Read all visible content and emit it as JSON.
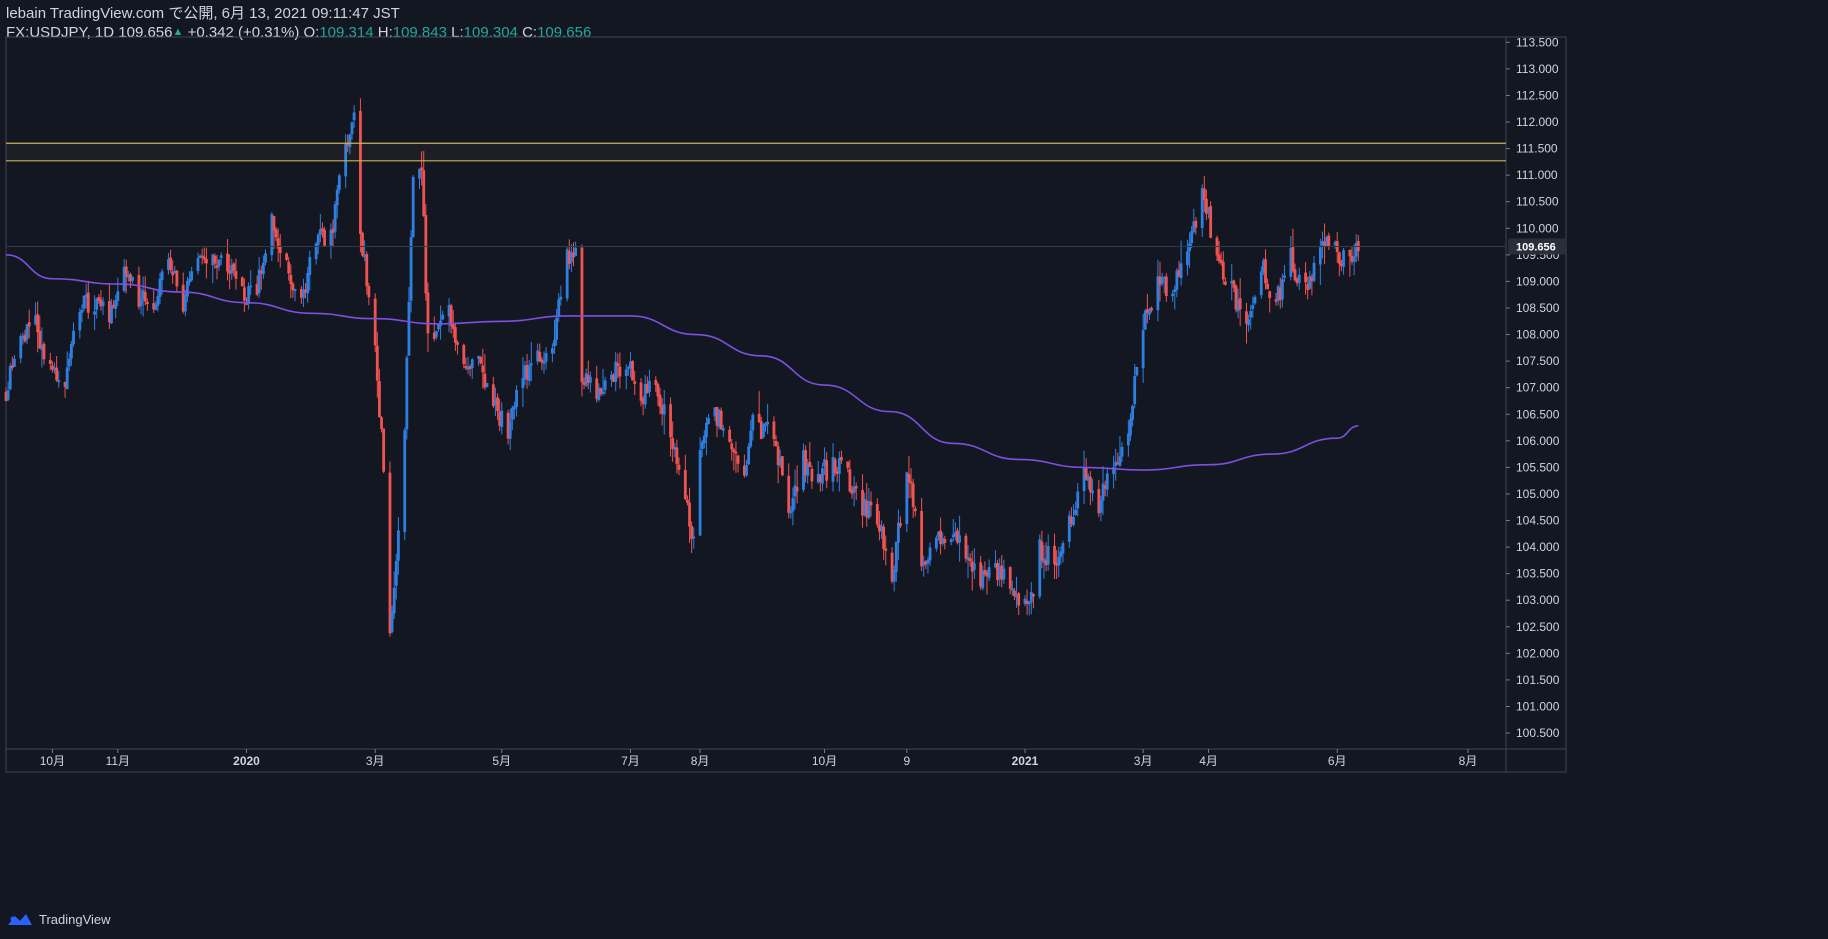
{
  "header": {
    "publisher": "lebain TradingView.com で公開, 6月 13, 2021 09:11:47 JST",
    "symbol": "FX:USDJPY, 1D",
    "last": "109.656",
    "change_icon": "up-triangle-icon",
    "change": "+0.342 (+0.31%)",
    "o_label": "O:",
    "o_value": "109.314",
    "h_label": "H:",
    "h_value": "109.843",
    "l_label": "L:",
    "l_value": "109.304",
    "c_label": "C:",
    "c_value": "109.656"
  },
  "footer": {
    "brand": "TradingView",
    "logo_icon": "tradingview-logo-icon"
  },
  "colors": {
    "background": "#131722",
    "up": "#2f7fe0",
    "down": "#f05350",
    "ma": "#7e4fe0",
    "resistance": "#c9b458",
    "text": "#d1d4dc",
    "green": "#26a69a"
  },
  "chart_data": {
    "type": "candlestick",
    "symbol": "FX:USDJPY",
    "timeframe": "1D",
    "y_axis": {
      "min": 100.2,
      "max": 113.6,
      "ticks": [
        "113.500",
        "113.000",
        "112.500",
        "112.000",
        "111.500",
        "111.000",
        "110.500",
        "110.000",
        "109.500",
        "109.000",
        "108.500",
        "108.000",
        "107.500",
        "107.000",
        "106.500",
        "106.000",
        "105.500",
        "105.000",
        "104.500",
        "104.000",
        "103.500",
        "103.000",
        "102.500",
        "102.000",
        "101.500",
        "101.000",
        "100.500"
      ]
    },
    "x_axis": {
      "start": "2019-09-09",
      "end": "2021-08-20",
      "ticks": [
        {
          "label": "10月",
          "date": "2019-10-01"
        },
        {
          "label": "11月",
          "date": "2019-11-01"
        },
        {
          "label": "2020",
          "date": "2020-01-01",
          "bold": true
        },
        {
          "label": "3月",
          "date": "2020-03-02"
        },
        {
          "label": "5月",
          "date": "2020-05-01"
        },
        {
          "label": "7月",
          "date": "2020-07-01"
        },
        {
          "label": "8月",
          "date": "2020-08-03"
        },
        {
          "label": "10月",
          "date": "2020-10-01"
        },
        {
          "label": "9",
          "date": "2020-11-09"
        },
        {
          "label": "2021",
          "date": "2021-01-04",
          "bold": true
        },
        {
          "label": "3月",
          "date": "2021-03-01"
        },
        {
          "label": "4月",
          "date": "2021-04-01"
        },
        {
          "label": "6月",
          "date": "2021-06-01"
        },
        {
          "label": "8月",
          "date": "2021-08-02"
        }
      ]
    },
    "last_price": "109.656",
    "resistance_zone": [
      111.27,
      111.6
    ],
    "close_path": [
      [
        "2019-09-09",
        106.9
      ],
      [
        "2019-09-16",
        107.9
      ],
      [
        "2019-09-23",
        108.2
      ],
      [
        "2019-09-30",
        107.3
      ],
      [
        "2019-10-07",
        107.0
      ],
      [
        "2019-10-14",
        108.6
      ],
      [
        "2019-10-21",
        108.6
      ],
      [
        "2019-10-28",
        108.4
      ],
      [
        "2019-11-04",
        109.2
      ],
      [
        "2019-11-11",
        108.7
      ],
      [
        "2019-11-18",
        108.6
      ],
      [
        "2019-11-25",
        109.4
      ],
      [
        "2019-12-02",
        108.6
      ],
      [
        "2019-12-09",
        109.5
      ],
      [
        "2019-12-16",
        109.4
      ],
      [
        "2019-12-23",
        109.4
      ],
      [
        "2019-12-30",
        108.7
      ],
      [
        "2020-01-06",
        108.9
      ],
      [
        "2020-01-13",
        110.1
      ],
      [
        "2020-01-20",
        109.3
      ],
      [
        "2020-01-27",
        108.6
      ],
      [
        "2020-02-03",
        109.8
      ],
      [
        "2020-02-10",
        109.8
      ],
      [
        "2020-02-17",
        111.6
      ],
      [
        "2020-02-21",
        112.1
      ],
      [
        "2020-02-24",
        110.0
      ],
      [
        "2020-03-02",
        107.8
      ],
      [
        "2020-03-06",
        105.5
      ],
      [
        "2020-03-09",
        102.3
      ],
      [
        "2020-03-13",
        104.5
      ],
      [
        "2020-03-16",
        106.3
      ],
      [
        "2020-03-20",
        110.8
      ],
      [
        "2020-03-24",
        111.2
      ],
      [
        "2020-03-27",
        107.8
      ],
      [
        "2020-03-30",
        108.0
      ],
      [
        "2020-04-06",
        108.5
      ],
      [
        "2020-04-13",
        107.3
      ],
      [
        "2020-04-20",
        107.6
      ],
      [
        "2020-04-27",
        106.7
      ],
      [
        "2020-05-04",
        106.2
      ],
      [
        "2020-05-11",
        107.2
      ],
      [
        "2020-05-18",
        107.6
      ],
      [
        "2020-05-25",
        107.7
      ],
      [
        "2020-06-01",
        109.5
      ],
      [
        "2020-06-05",
        109.6
      ],
      [
        "2020-06-08",
        107.3
      ],
      [
        "2020-06-15",
        106.9
      ],
      [
        "2020-06-22",
        107.2
      ],
      [
        "2020-06-29",
        107.5
      ],
      [
        "2020-07-06",
        106.9
      ],
      [
        "2020-07-13",
        107.0
      ],
      [
        "2020-07-20",
        106.1
      ],
      [
        "2020-07-31",
        104.2
      ],
      [
        "2020-08-03",
        105.8
      ],
      [
        "2020-08-10",
        106.6
      ],
      [
        "2020-08-17",
        105.8
      ],
      [
        "2020-08-24",
        105.4
      ],
      [
        "2020-08-28",
        106.3
      ],
      [
        "2020-09-07",
        106.1
      ],
      [
        "2020-09-14",
        104.6
      ],
      [
        "2020-09-21",
        105.6
      ],
      [
        "2020-09-28",
        105.3
      ],
      [
        "2020-10-05",
        105.6
      ],
      [
        "2020-10-12",
        105.3
      ],
      [
        "2020-10-19",
        104.7
      ],
      [
        "2020-10-26",
        104.6
      ],
      [
        "2020-11-02",
        103.4
      ],
      [
        "2020-11-09",
        105.5
      ],
      [
        "2020-11-16",
        103.8
      ],
      [
        "2020-11-23",
        104.1
      ],
      [
        "2020-11-30",
        104.2
      ],
      [
        "2020-12-07",
        104.0
      ],
      [
        "2020-12-14",
        103.3
      ],
      [
        "2020-12-21",
        103.6
      ],
      [
        "2020-12-28",
        103.2
      ],
      [
        "2021-01-06",
        102.8
      ],
      [
        "2021-01-11",
        104.0
      ],
      [
        "2021-01-18",
        103.7
      ],
      [
        "2021-01-25",
        104.4
      ],
      [
        "2021-02-01",
        105.3
      ],
      [
        "2021-02-08",
        104.8
      ],
      [
        "2021-02-15",
        105.5
      ],
      [
        "2021-02-22",
        106.1
      ],
      [
        "2021-03-01",
        108.3
      ],
      [
        "2021-03-08",
        109.0
      ],
      [
        "2021-03-15",
        108.9
      ],
      [
        "2021-03-22",
        109.5
      ],
      [
        "2021-03-29",
        110.6
      ],
      [
        "2021-04-05",
        109.6
      ],
      [
        "2021-04-12",
        108.8
      ],
      [
        "2021-04-19",
        108.0
      ],
      [
        "2021-04-26",
        109.3
      ],
      [
        "2021-05-03",
        108.6
      ],
      [
        "2021-05-10",
        109.4
      ],
      [
        "2021-05-17",
        108.8
      ],
      [
        "2021-05-24",
        109.8
      ],
      [
        "2021-06-01",
        109.5
      ],
      [
        "2021-06-07",
        109.5
      ],
      [
        "2021-06-11",
        109.66
      ]
    ],
    "moving_average": {
      "color": "#7e4fe0",
      "points": [
        [
          "2019-09-09",
          109.5
        ],
        [
          "2019-10-01",
          109.05
        ],
        [
          "2019-11-01",
          108.95
        ],
        [
          "2019-12-01",
          108.8
        ],
        [
          "2020-01-01",
          108.6
        ],
        [
          "2020-02-01",
          108.4
        ],
        [
          "2020-03-01",
          108.3
        ],
        [
          "2020-04-01",
          108.2
        ],
        [
          "2020-05-01",
          108.25
        ],
        [
          "2020-06-01",
          108.35
        ],
        [
          "2020-07-01",
          108.35
        ],
        [
          "2020-08-01",
          108.0
        ],
        [
          "2020-09-01",
          107.6
        ],
        [
          "2020-10-01",
          107.05
        ],
        [
          "2020-11-01",
          106.55
        ],
        [
          "2020-12-01",
          105.95
        ],
        [
          "2021-01-01",
          105.65
        ],
        [
          "2021-02-01",
          105.5
        ],
        [
          "2021-03-01",
          105.45
        ],
        [
          "2021-04-01",
          105.55
        ],
        [
          "2021-05-01",
          105.75
        ],
        [
          "2021-06-01",
          106.05
        ],
        [
          "2021-06-11",
          106.28
        ]
      ]
    }
  }
}
